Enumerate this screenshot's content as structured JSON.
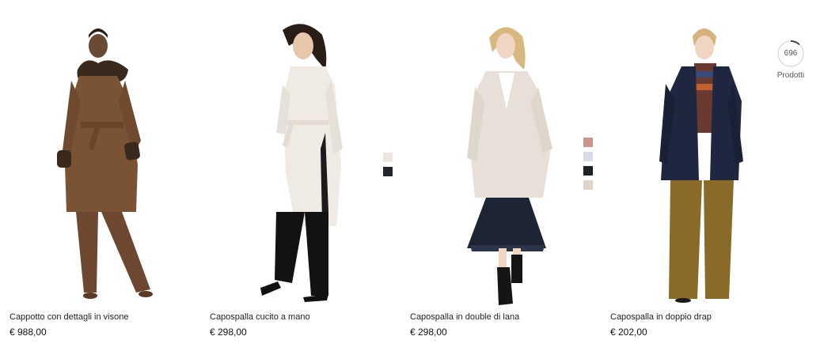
{
  "products": [
    {
      "name": "Cappotto con dettagli in visone",
      "price": "€ 988,00",
      "swatches": []
    },
    {
      "name": "Capospalla cucito a mano",
      "price": "€ 298,00",
      "swatches": [
        "#ece6de",
        "#22252c"
      ]
    },
    {
      "name": "Capospalla in double di lana",
      "price": "€ 298,00",
      "swatches": [
        "#c9958a",
        "#d8dbe8",
        "#1e2226",
        "#ddd4cc"
      ]
    },
    {
      "name": "Capospalla in doppio drap",
      "price": "€ 202,00",
      "swatches": []
    }
  ],
  "counter": {
    "count": "696",
    "label": "Prodotti",
    "progress": 0.12
  },
  "colors": {
    "brown_coat": "#7a5234",
    "cream_coat": "#efebe4",
    "ivory_coat": "#e8e0d8",
    "navy_coat": "#1f2740",
    "mustard_trousers": "#8a6a28"
  }
}
